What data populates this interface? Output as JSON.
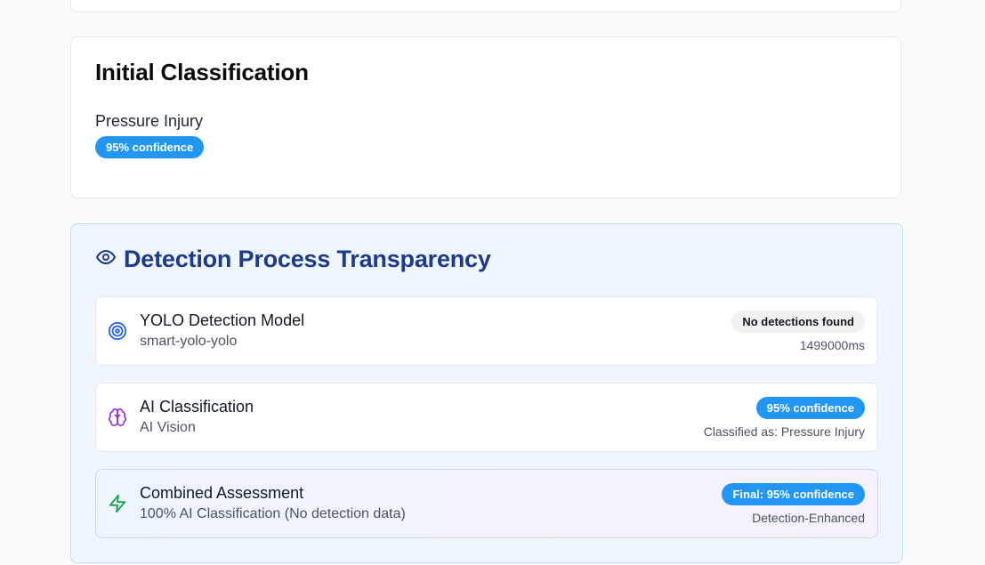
{
  "initial": {
    "title": "Initial Classification",
    "classification": "Pressure Injury",
    "confidence_badge": "95% confidence"
  },
  "transparency": {
    "title": "Detection Process Transparency",
    "title_icon": "eye-icon",
    "rows": [
      {
        "icon": "target-icon",
        "name": "YOLO Detection Model",
        "sub": "smart-yolo-yolo",
        "badge": "No detections found",
        "meta": "1499000ms"
      },
      {
        "icon": "brain-icon",
        "name": "AI Classification",
        "sub": "AI Vision",
        "badge": "95% confidence",
        "meta": "Classified as: Pressure Injury"
      },
      {
        "icon": "lightning-icon",
        "name": "Combined Assessment",
        "sub": "100% AI Classification (No detection data)",
        "badge": "Final: 95% confidence",
        "meta": "Detection-Enhanced"
      }
    ]
  },
  "colors": {
    "accent_blue": "#2196f3",
    "title_navy": "#1e3a8a",
    "brain_purple": "#9333ea",
    "bolt_green": "#16a34a"
  }
}
